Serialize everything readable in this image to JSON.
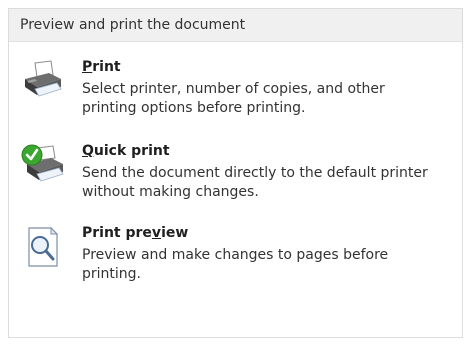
{
  "panel": {
    "header": "Preview and print the document"
  },
  "items": [
    {
      "title_pre": "",
      "title_key": "P",
      "title_post": "rint",
      "description": "Select printer, number of copies, and other printing options before printing.",
      "icon": "printer-icon"
    },
    {
      "title_pre": "",
      "title_key": "Q",
      "title_post": "uick print",
      "description": "Send the document directly to the default printer without making changes.",
      "icon": "quick-print-icon"
    },
    {
      "title_pre": "Print pre",
      "title_key": "v",
      "title_post": "iew",
      "description": "Preview and make changes to pages before printing.",
      "icon": "print-preview-icon"
    }
  ]
}
